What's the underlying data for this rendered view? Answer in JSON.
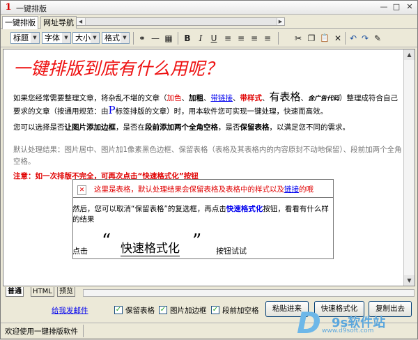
{
  "window": {
    "title": "一键排版",
    "app_icon_glyph": "1",
    "minimize": "—",
    "maximize": "□",
    "close": "✕"
  },
  "top_tabs": [
    {
      "label": "一键排版"
    },
    {
      "label": "网址导航"
    }
  ],
  "toolbar": {
    "combos": [
      {
        "label": "标题"
      },
      {
        "label": "字体"
      },
      {
        "label": "大小"
      },
      {
        "label": "格式"
      }
    ],
    "icons": {
      "link": "⚭",
      "hr": "—",
      "table": "▦",
      "bold": "B",
      "italic": "I",
      "underline": "U",
      "align_left": "≡",
      "align_center": "≡",
      "align_right": "≡",
      "justify": "≡",
      "cut": "✂",
      "copy": "❐",
      "paste": "📋",
      "delete": "✕",
      "undo": "↶",
      "redo": "↷",
      "edit": "✎"
    }
  },
  "editor": {
    "heading": "一键排版到底有什么用呢？",
    "p1": {
      "a": "如果您经常需要整理文章，将杂乱不堪的文章（",
      "red": "加色",
      "sep1": "、",
      "bold": "加粗",
      "sep2": "、",
      "link": "带链接",
      "sep3": "、",
      "style": "带样式",
      "sep4": "、",
      "table": "有表格",
      "sep5": "、",
      "ad": "含广告代码",
      "b": "）整理成符合自己",
      "line2a": "要求的文章（按通用规范：由",
      "P": "P",
      "line2b": "标签排版的文章）时，用本软件您可实现一键处理，快速而高效。"
    },
    "p2": {
      "a": "您可以选择是否",
      "b1": "让图片添加边框",
      "b": "，是否在",
      "b2": "段前添加两个全角空格",
      "c": "，是否",
      "b3": "保留表格",
      "d": "，以满足您不同的需求。"
    },
    "gray": "默认处理结果：图片居中、图片加1像素黑色边框、保留表格（表格及其表格内的内容原封不动地保留）、段前加两个全角空格。",
    "note": "注意：如一次排版不完全，可再次点击“快速格式化”按钮",
    "table_cell": {
      "a": "这里是表格，默认处理结果会保留表格及表格中的样式以及",
      "link": "链接",
      "b": "的哦"
    },
    "table_para": {
      "a": "然后，您可以取消“保留表格”的复选框，再点击",
      "link": "快速格式化",
      "b": "按钮，看看有什么样的结果"
    },
    "quote": {
      "click": "点击",
      "open": "“",
      "big": "快速格式化",
      "close": "”",
      "try": "按钮试试"
    }
  },
  "bottom_tabs": [
    {
      "label": "普通"
    },
    {
      "label": "HTML"
    },
    {
      "label": "预览"
    }
  ],
  "bottom_bar": {
    "mail_link": "给我发邮件",
    "checkboxes": [
      {
        "label": "保留表格",
        "checked": true
      },
      {
        "label": "图片加边框",
        "checked": true
      },
      {
        "label": "段前加空格",
        "checked": true
      }
    ],
    "buttons": [
      {
        "label": "粘贴进来"
      },
      {
        "label": "快速格式化"
      },
      {
        "label": "复制出去"
      }
    ]
  },
  "status": {
    "text": "欢迎使用一键排版软件"
  },
  "watermark": {
    "logo": "D",
    "text": "9s软件站",
    "url": "www.d9soft.com"
  },
  "colors": {
    "accent_red": "#ee1111",
    "link_blue": "#0000ee",
    "watermark_blue": "#5aa6dd"
  }
}
